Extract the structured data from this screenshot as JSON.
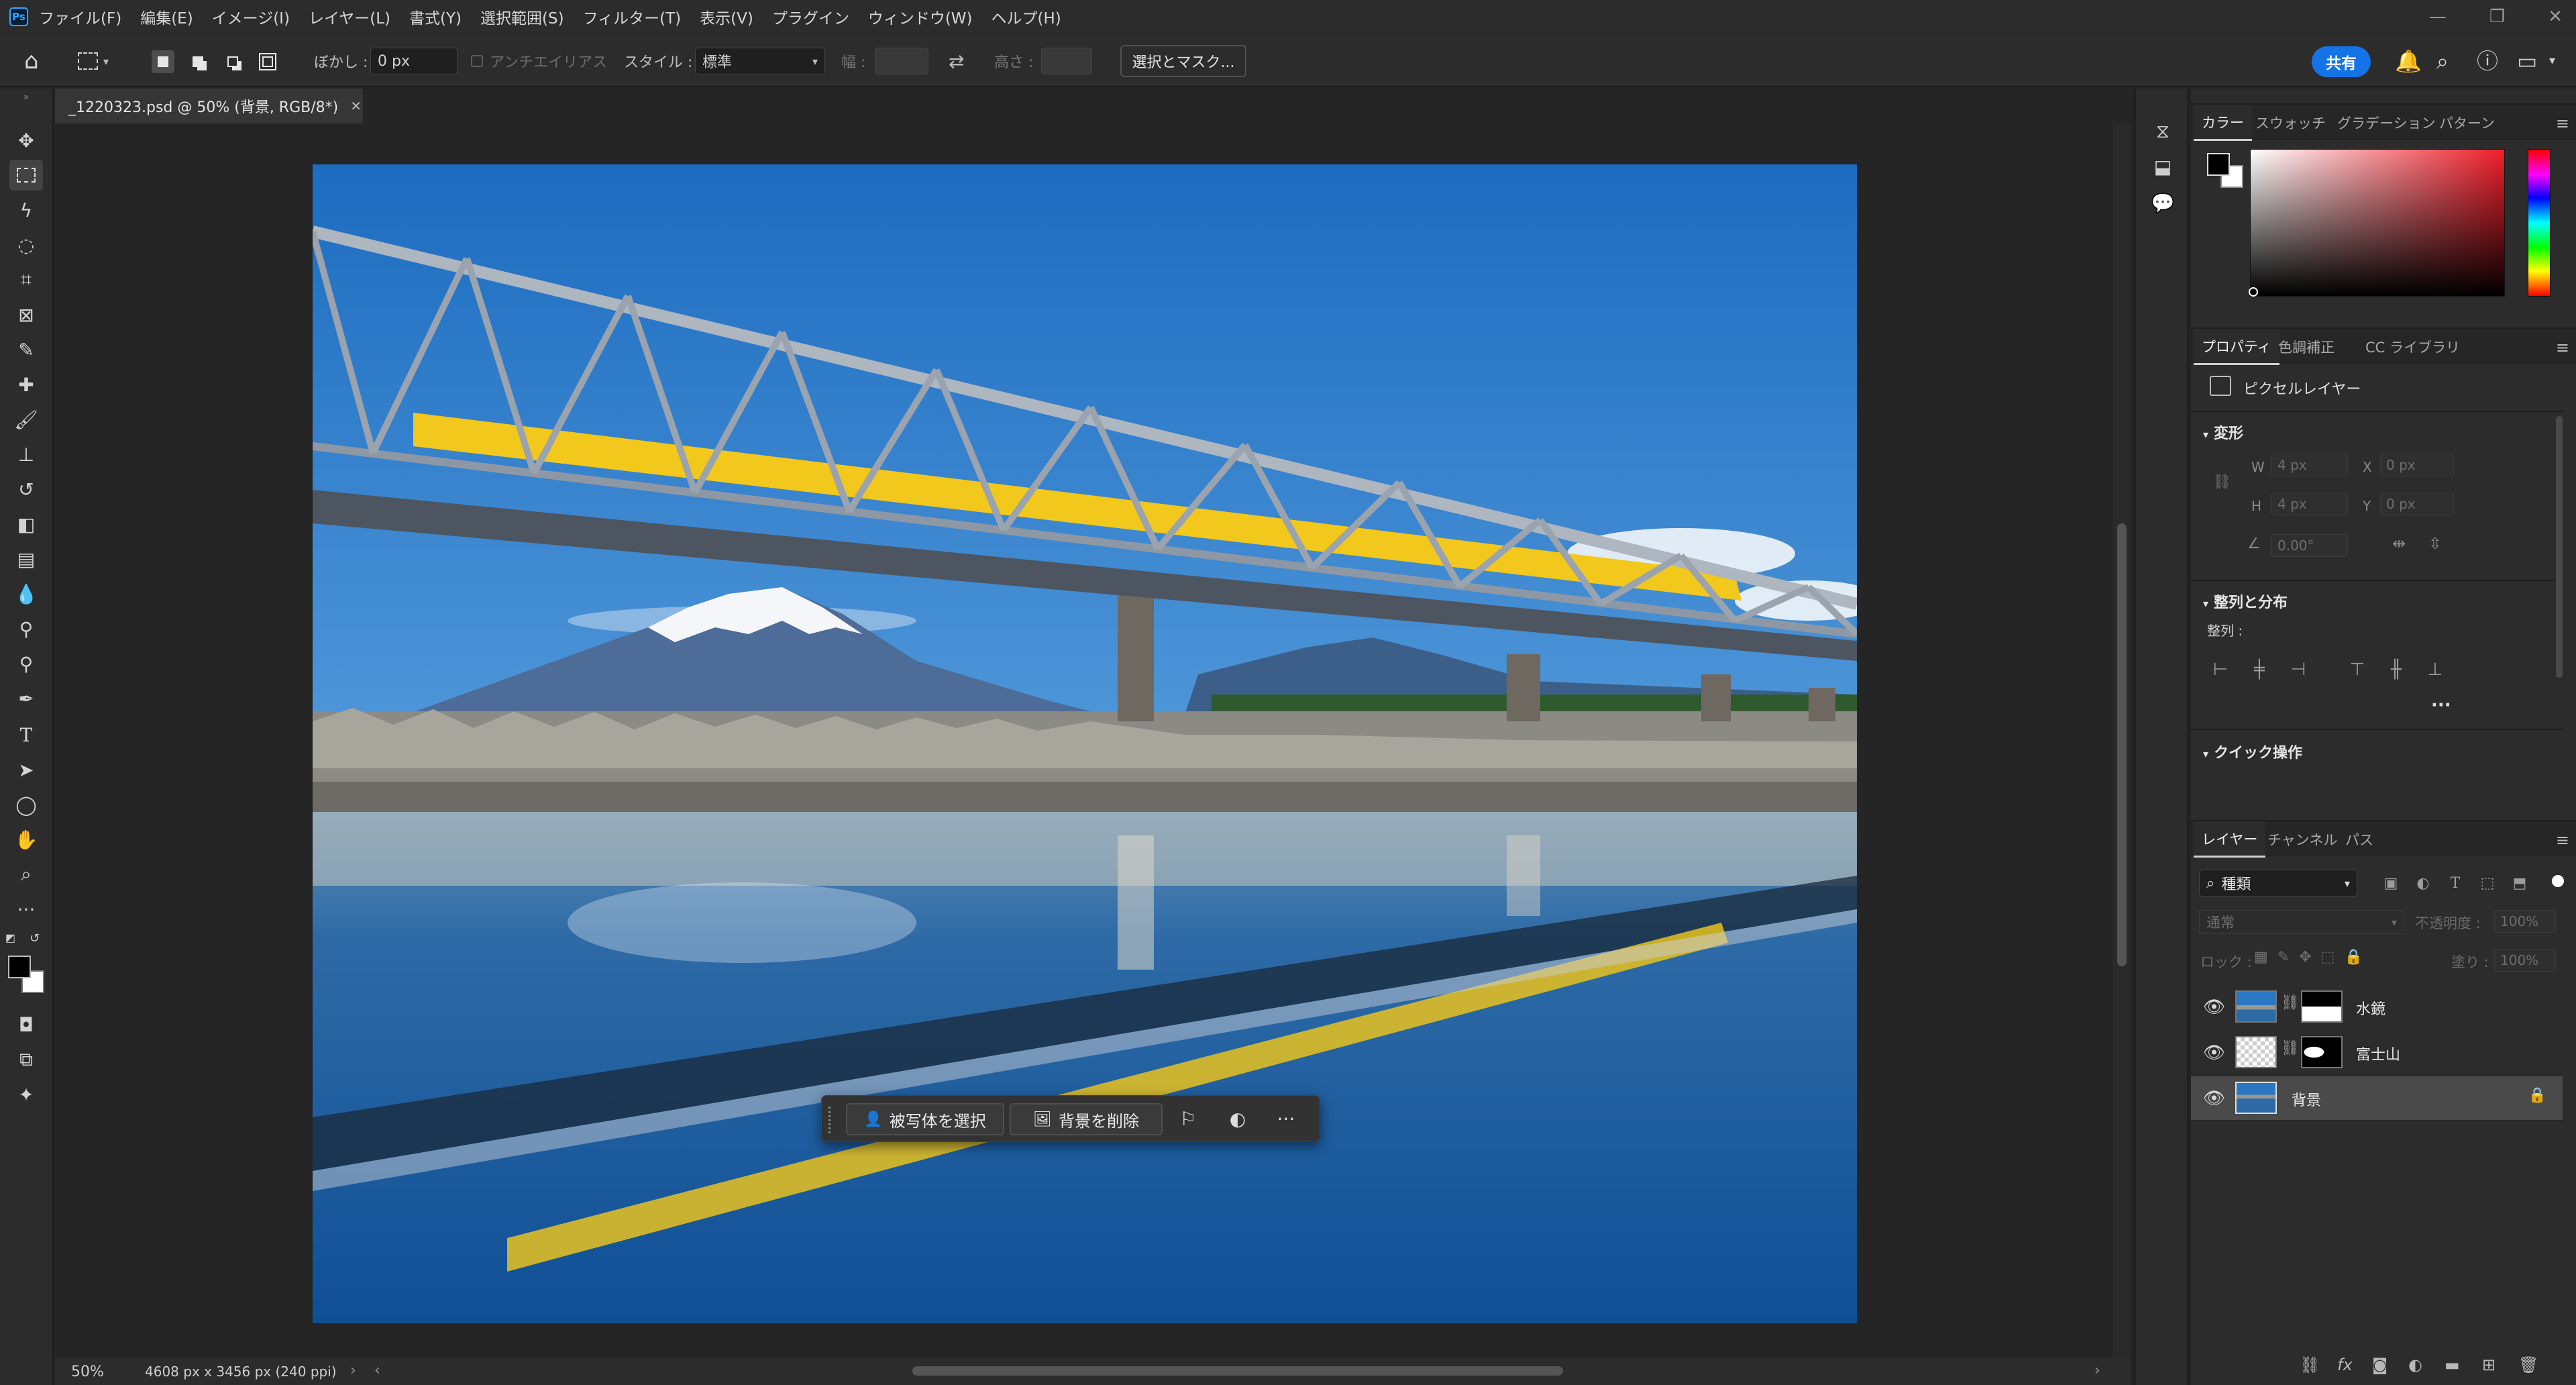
{
  "app": {
    "logo": "Ps",
    "menu": [
      "ファイル(F)",
      "編集(E)",
      "イメージ(I)",
      "レイヤー(L)",
      "書式(Y)",
      "選択範囲(S)",
      "フィルター(T)",
      "表示(V)",
      "プラグイン",
      "ウィンドウ(W)",
      "ヘルプ(H)"
    ],
    "window_controls": [
      "—",
      "❐",
      "✕"
    ]
  },
  "options": {
    "feather_label": "ぼかし :",
    "feather_value": "0 px",
    "antialias_label": "アンチエイリアス",
    "style_label": "スタイル :",
    "style_value": "標準",
    "width_label": "幅 :",
    "height_label": "高さ :",
    "select_mask_label": "選択とマスク...",
    "share_label": "共有"
  },
  "document": {
    "tab_title": "_1220323.psd @ 50% (背景, RGB/8*)",
    "zoom": "50%",
    "info": "4608 px x 3456 px (240 ppi)"
  },
  "taskbar": {
    "select_subject": "被写体を選択",
    "remove_bg": "背景を削除",
    "more": "···"
  },
  "color_panel": {
    "tabs": [
      "カラー",
      "スウォッチ",
      "グラデーション",
      "パターン"
    ],
    "foreground": "#000000",
    "background": "#ffffff"
  },
  "properties_panel": {
    "tabs": [
      "プロパティ",
      "色調補正",
      "CC ライブラリ"
    ],
    "layer_type": "ピクセルレイヤー",
    "transform_title": "変形",
    "w_label": "W",
    "w_value": "4 px",
    "h_label": "H",
    "h_value": "4 px",
    "x_label": "X",
    "x_value": "0 px",
    "y_label": "Y",
    "y_value": "0 px",
    "angle_value": "0.00°",
    "align_title": "整列と分布",
    "align_label": "整列 :",
    "align_more": "···",
    "quick_title": "クイック操作"
  },
  "layers_panel": {
    "tabs": [
      "レイヤー",
      "チャンネル",
      "パス"
    ],
    "filter_kind": "種類",
    "blend_mode": "通常",
    "opacity_label": "不透明度 :",
    "opacity_value": "100%",
    "lock_label": "ロック :",
    "fill_label": "塗り :",
    "fill_value": "100%",
    "layers": [
      {
        "name": "水鏡",
        "visible": true,
        "selected": false,
        "locked": false
      },
      {
        "name": "富士山",
        "visible": true,
        "selected": false,
        "locked": false
      },
      {
        "name": "背景",
        "visible": true,
        "selected": true,
        "locked": true
      }
    ]
  },
  "colors": {
    "accent": "#1473e6",
    "sky": "#1e6fbf",
    "train": "#f2c81c"
  }
}
